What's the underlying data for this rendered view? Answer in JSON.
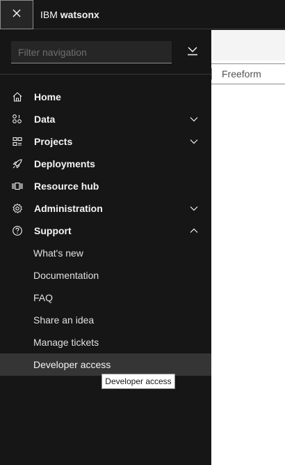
{
  "header": {
    "close_icon": "close-icon",
    "brand_prefix": "IBM",
    "brand_name": "watsonx"
  },
  "background": {
    "tab_label": "Freeform"
  },
  "sidenav": {
    "filter": {
      "placeholder": "Filter navigation",
      "value": ""
    },
    "collapse_icon": "collapse-all-icon",
    "items": [
      {
        "label": "Home",
        "icon": "home-icon",
        "chevron": "none"
      },
      {
        "label": "Data",
        "icon": "data-icon",
        "chevron": "down"
      },
      {
        "label": "Projects",
        "icon": "projects-icon",
        "chevron": "down"
      },
      {
        "label": "Deployments",
        "icon": "rocket-icon",
        "chevron": "none"
      },
      {
        "label": "Resource hub",
        "icon": "resource-hub-icon",
        "chevron": "none"
      },
      {
        "label": "Administration",
        "icon": "gear-icon",
        "chevron": "down"
      },
      {
        "label": "Support",
        "icon": "help-icon",
        "chevron": "up"
      }
    ],
    "support_subitems": [
      {
        "label": "What's new"
      },
      {
        "label": "Documentation"
      },
      {
        "label": "FAQ"
      },
      {
        "label": "Share an idea"
      },
      {
        "label": "Manage tickets"
      },
      {
        "label": "Developer access",
        "active": true
      }
    ]
  },
  "tooltip": {
    "text": "Developer access"
  },
  "colors": {
    "nav_bg": "#161616",
    "active_bg": "#353535",
    "text": "#f4f4f4",
    "page_bg": "#ffffff"
  }
}
